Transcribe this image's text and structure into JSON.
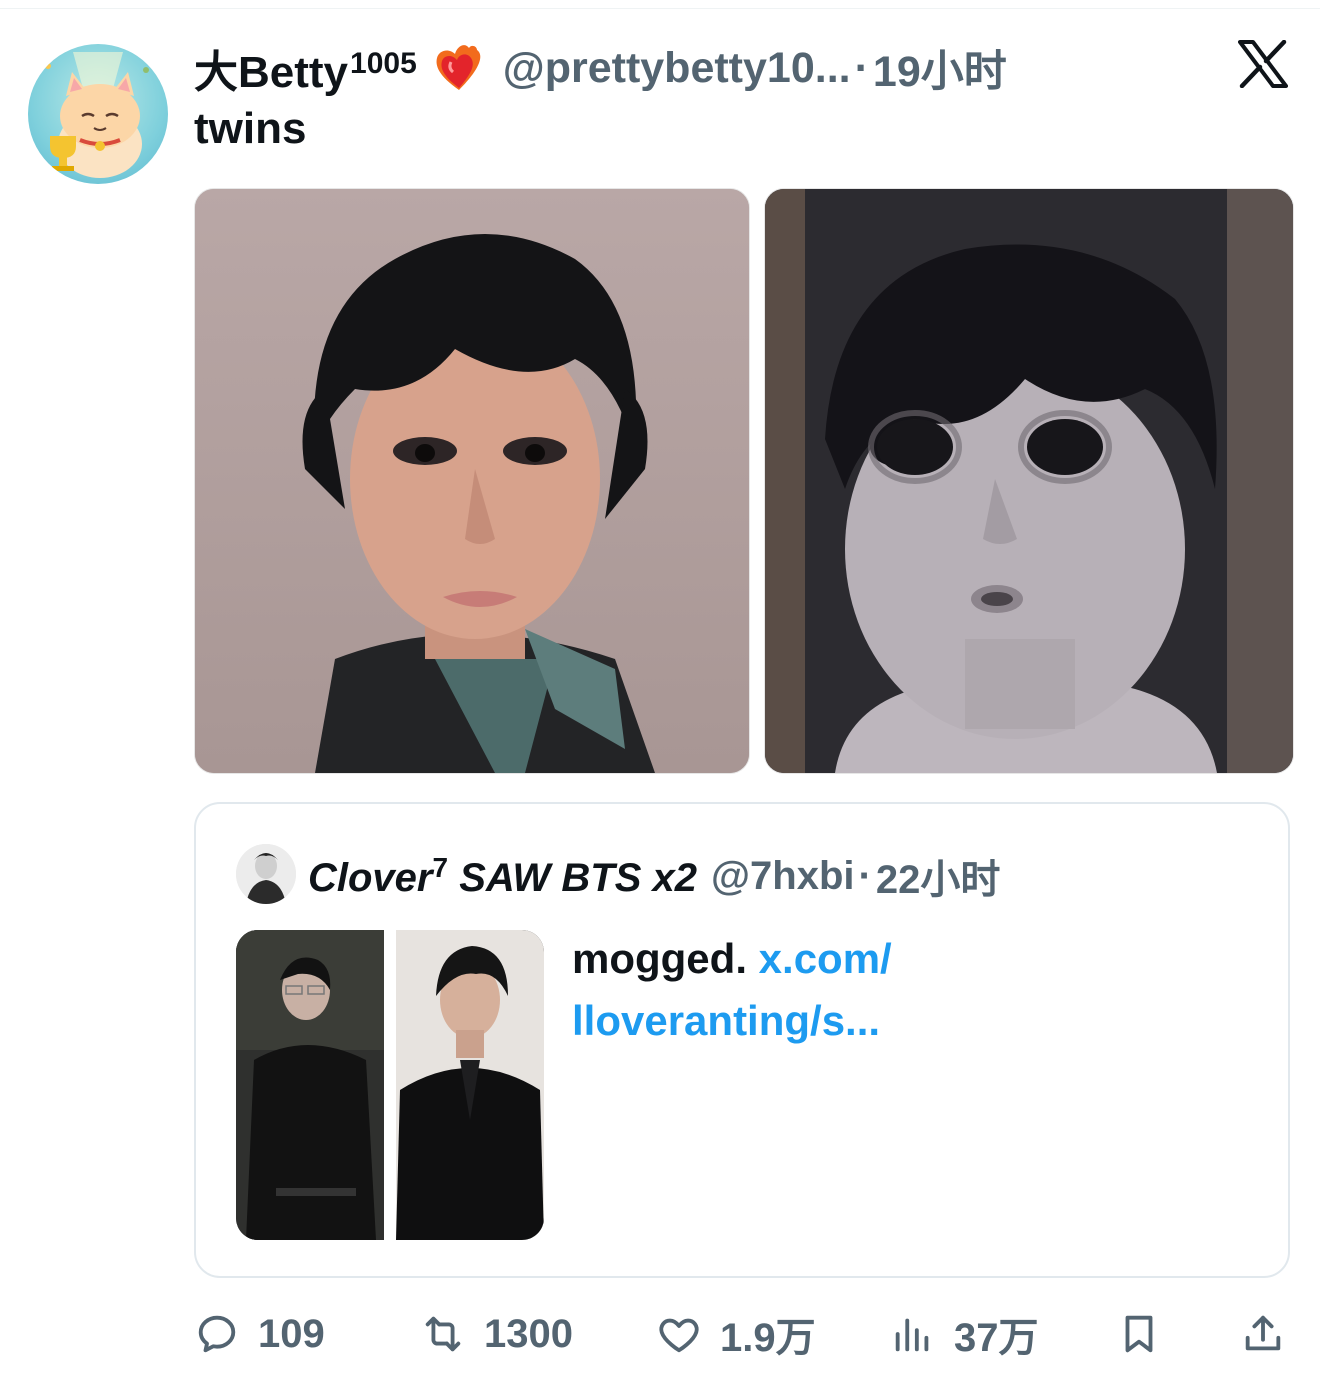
{
  "tweet": {
    "display_name": "大Betty",
    "display_name_sup": "1005",
    "heart_icon": "heart-on-fire-emoji",
    "handle": "@prettybetty10...",
    "separator": "·",
    "time": "19小时",
    "text": "twins",
    "brand_icon": "x-logo-icon"
  },
  "quote": {
    "display_name": "Clover",
    "display_name_sup": "7",
    "display_name_rest": " SAW BTS x2",
    "handle": "@7hxbi",
    "separator": "·",
    "time": "22小时",
    "text": "mogged.",
    "link_line1": "x.com/",
    "link_line2": "lloveranting/s..."
  },
  "actions": {
    "reply_count": "109",
    "retweet_count": "1300",
    "like_count": "1.9万",
    "views_count": "37万"
  },
  "colors": {
    "text_primary": "#0f1419",
    "text_secondary": "#536471",
    "link": "#1d9bf0",
    "border": "#e1e8ed"
  }
}
